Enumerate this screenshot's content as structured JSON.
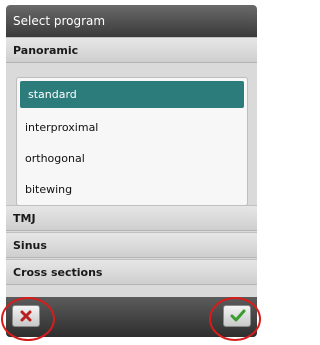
{
  "window": {
    "title": "Select program"
  },
  "sections": {
    "panoramic": "Panoramic",
    "tmj": "TMJ",
    "sinus": "Sinus",
    "cross_sections": "Cross sections"
  },
  "programs": [
    "standard",
    "interproximal",
    "orthogonal",
    "bitewing"
  ],
  "selected_program": "standard",
  "buttons": {
    "cancel_icon": "close-icon",
    "confirm_icon": "checkmark-icon"
  },
  "colors": {
    "selection": "#2d7c7c",
    "cancel_icon": "#b81f1f",
    "confirm_icon": "#3a9b2e",
    "annotation": "#d81c1c"
  }
}
